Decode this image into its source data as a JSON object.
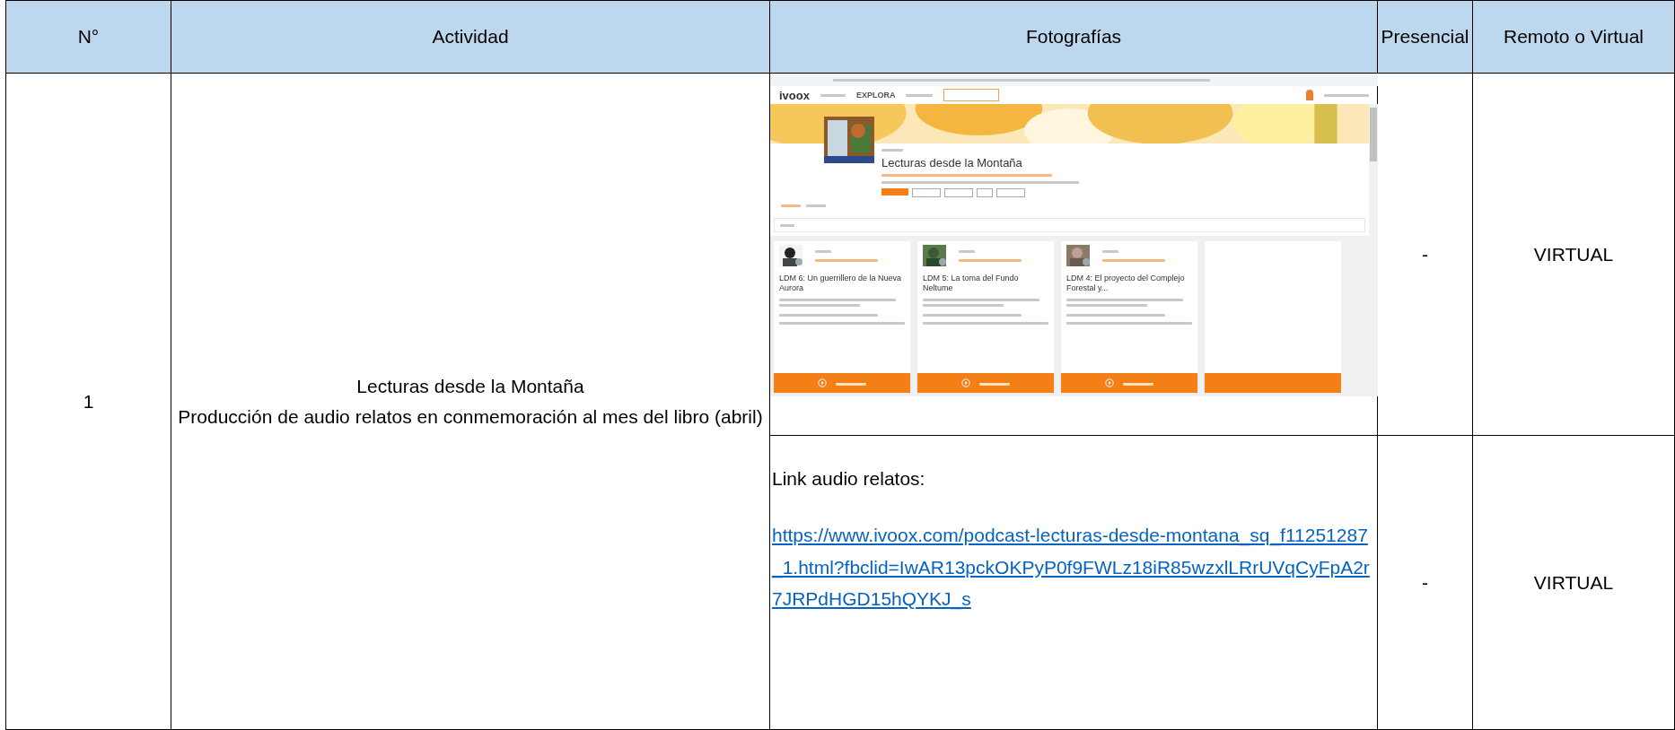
{
  "header": {
    "columns": [
      "N°",
      "Actividad",
      "Fotografías",
      "Presencial",
      "Remoto o Virtual"
    ]
  },
  "rows": [
    {
      "number": "1",
      "activity": [
        "Lecturas desde la Montaña",
        "Producción de audio relatos en conmemoración al mes del libro  (abril)"
      ],
      "entries": [
        {
          "kind": "screenshot",
          "presencial": "-",
          "remote": "VIRTUAL",
          "screenshot": {
            "logo": "ivoox",
            "nav_tab": "EXPLORA",
            "podcast_title": "Lecturas desde la Montaña",
            "episodes": [
              {
                "title": "LDM 6: Un guerrillero de la Nueva Aurora"
              },
              {
                "title": "LDM 5: La toma del Fundo Neltume"
              },
              {
                "title": "LDM 4: El proyecto del Complejo Forestal y..."
              }
            ]
          }
        },
        {
          "kind": "link",
          "presencial": "-",
          "remote": "VIRTUAL",
          "label": "Link audio relatos:",
          "url": "https://www.ivoox.com/podcast-lecturas-desde-montana_sq_f11251287_1.html?fbclid=IwAR13pckOKPyP0f9FWLz18iR85wzxlLRrUVqCyFpA2r7JRPdHGD15hQYKJ_s"
        }
      ]
    }
  ]
}
